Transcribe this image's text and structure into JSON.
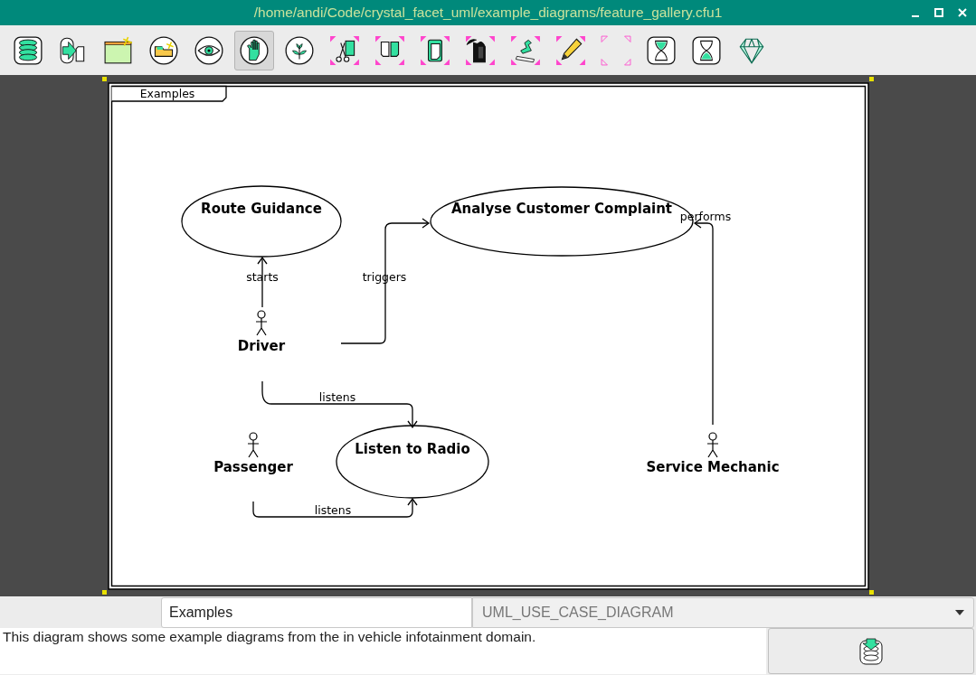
{
  "window": {
    "title": "/home/andi/Code/crystal_facet_uml/example_diagrams/feature_gallery.cfu1"
  },
  "toolbar": [
    {
      "kind": "database",
      "selected": false
    },
    {
      "kind": "export",
      "selected": false
    },
    {
      "kind": "window",
      "selected": false
    },
    {
      "kind": "folder",
      "selected": false
    },
    {
      "kind": "eye",
      "selected": false
    },
    {
      "kind": "hand",
      "selected": true
    },
    {
      "kind": "sprout",
      "selected": false
    },
    {
      "kind": "scissors",
      "selected": false
    },
    {
      "kind": "copy",
      "selected": false
    },
    {
      "kind": "document",
      "selected": false
    },
    {
      "kind": "figure",
      "selected": false
    },
    {
      "kind": "stamp",
      "selected": false
    },
    {
      "kind": "pencil",
      "selected": false
    },
    {
      "kind": "corners",
      "selected": false
    },
    {
      "kind": "hourglass-top",
      "selected": false
    },
    {
      "kind": "hourglass-bottom",
      "selected": false
    },
    {
      "kind": "gem",
      "selected": false
    }
  ],
  "diagram": {
    "title": "Examples",
    "use_cases": [
      {
        "name": "Route Guidance"
      },
      {
        "name": "Analyse Customer Complaint"
      },
      {
        "name": "Listen to Radio"
      }
    ],
    "actors": [
      {
        "name": "Driver"
      },
      {
        "name": "Passenger"
      },
      {
        "name": "Service Mechanic"
      }
    ],
    "relations": [
      {
        "label": "starts"
      },
      {
        "label": "triggers"
      },
      {
        "label": "listens"
      },
      {
        "label": "listens"
      },
      {
        "label": "performs"
      }
    ]
  },
  "footer": {
    "name_field": "Examples",
    "type_dropdown": "UML_USE_CASE_DIAGRAM",
    "description": "This diagram shows some example diagrams from the in vehicle infotainment domain."
  }
}
